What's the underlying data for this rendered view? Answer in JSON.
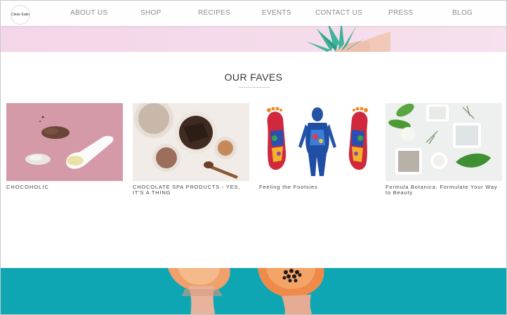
{
  "nav": {
    "logo_text": "Clean Eatin",
    "items": [
      {
        "label": "ABOUT US"
      },
      {
        "label": "SHOP"
      },
      {
        "label": "RECIPES"
      },
      {
        "label": "EVENTS"
      },
      {
        "label": "CONTACT US"
      },
      {
        "label": "PRESS"
      },
      {
        "label": "BLOG"
      }
    ]
  },
  "section": {
    "title": "OUR FAVES"
  },
  "cards": [
    {
      "caption": "CHOCOHOLIC",
      "image": "cocoa-powder-spoon-image"
    },
    {
      "caption": "CHOCOLATE SPA PRODUCTS - YES, IT'S A THING",
      "image": "chocolate-spa-bowls-image"
    },
    {
      "caption": "Feeling the Footsies",
      "image": "reflexology-feet-chart-image"
    },
    {
      "caption": "Formula Botanica: Formulate Your Way to Beauty",
      "image": "botanical-clay-powders-image"
    }
  ],
  "colors": {
    "hero_top": "#f5dceb",
    "hero_bottom": "#0fa6b4",
    "nav_text": "#8d8d8d",
    "card1_bg": "#d59aa8"
  }
}
